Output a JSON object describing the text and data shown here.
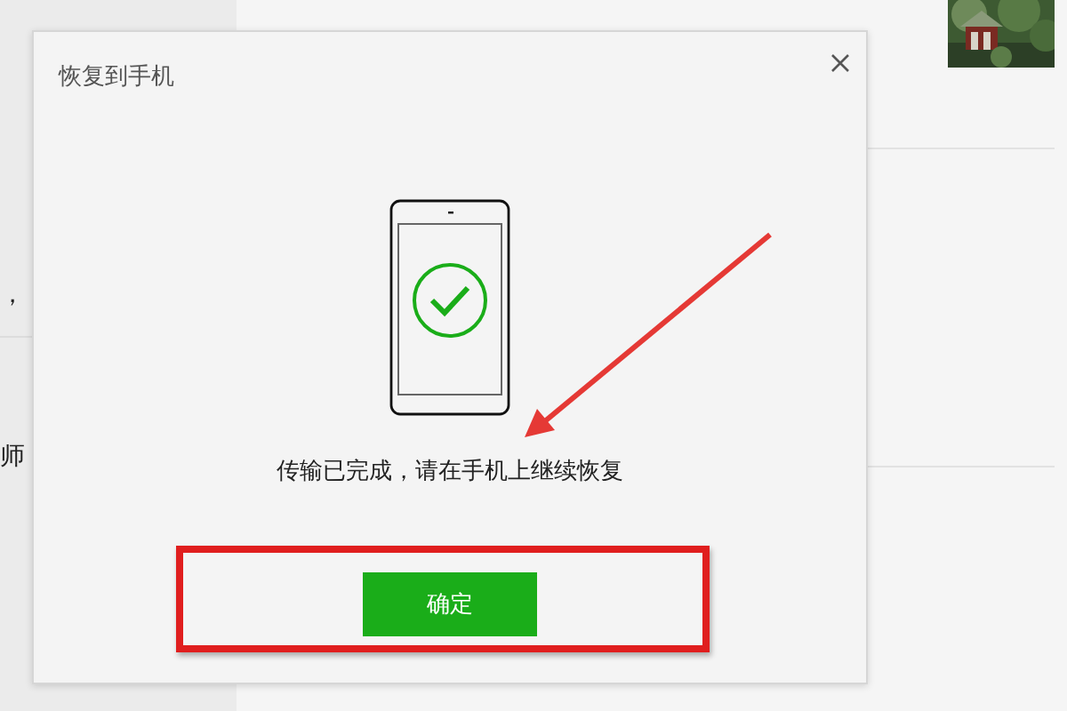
{
  "background": {
    "left_texts": [
      "，",
      "师"
    ]
  },
  "dialog": {
    "title": "恢复到手机",
    "status": {
      "done": true
    },
    "message": "传输已完成，请在手机上继续恢复",
    "button": "确定"
  }
}
